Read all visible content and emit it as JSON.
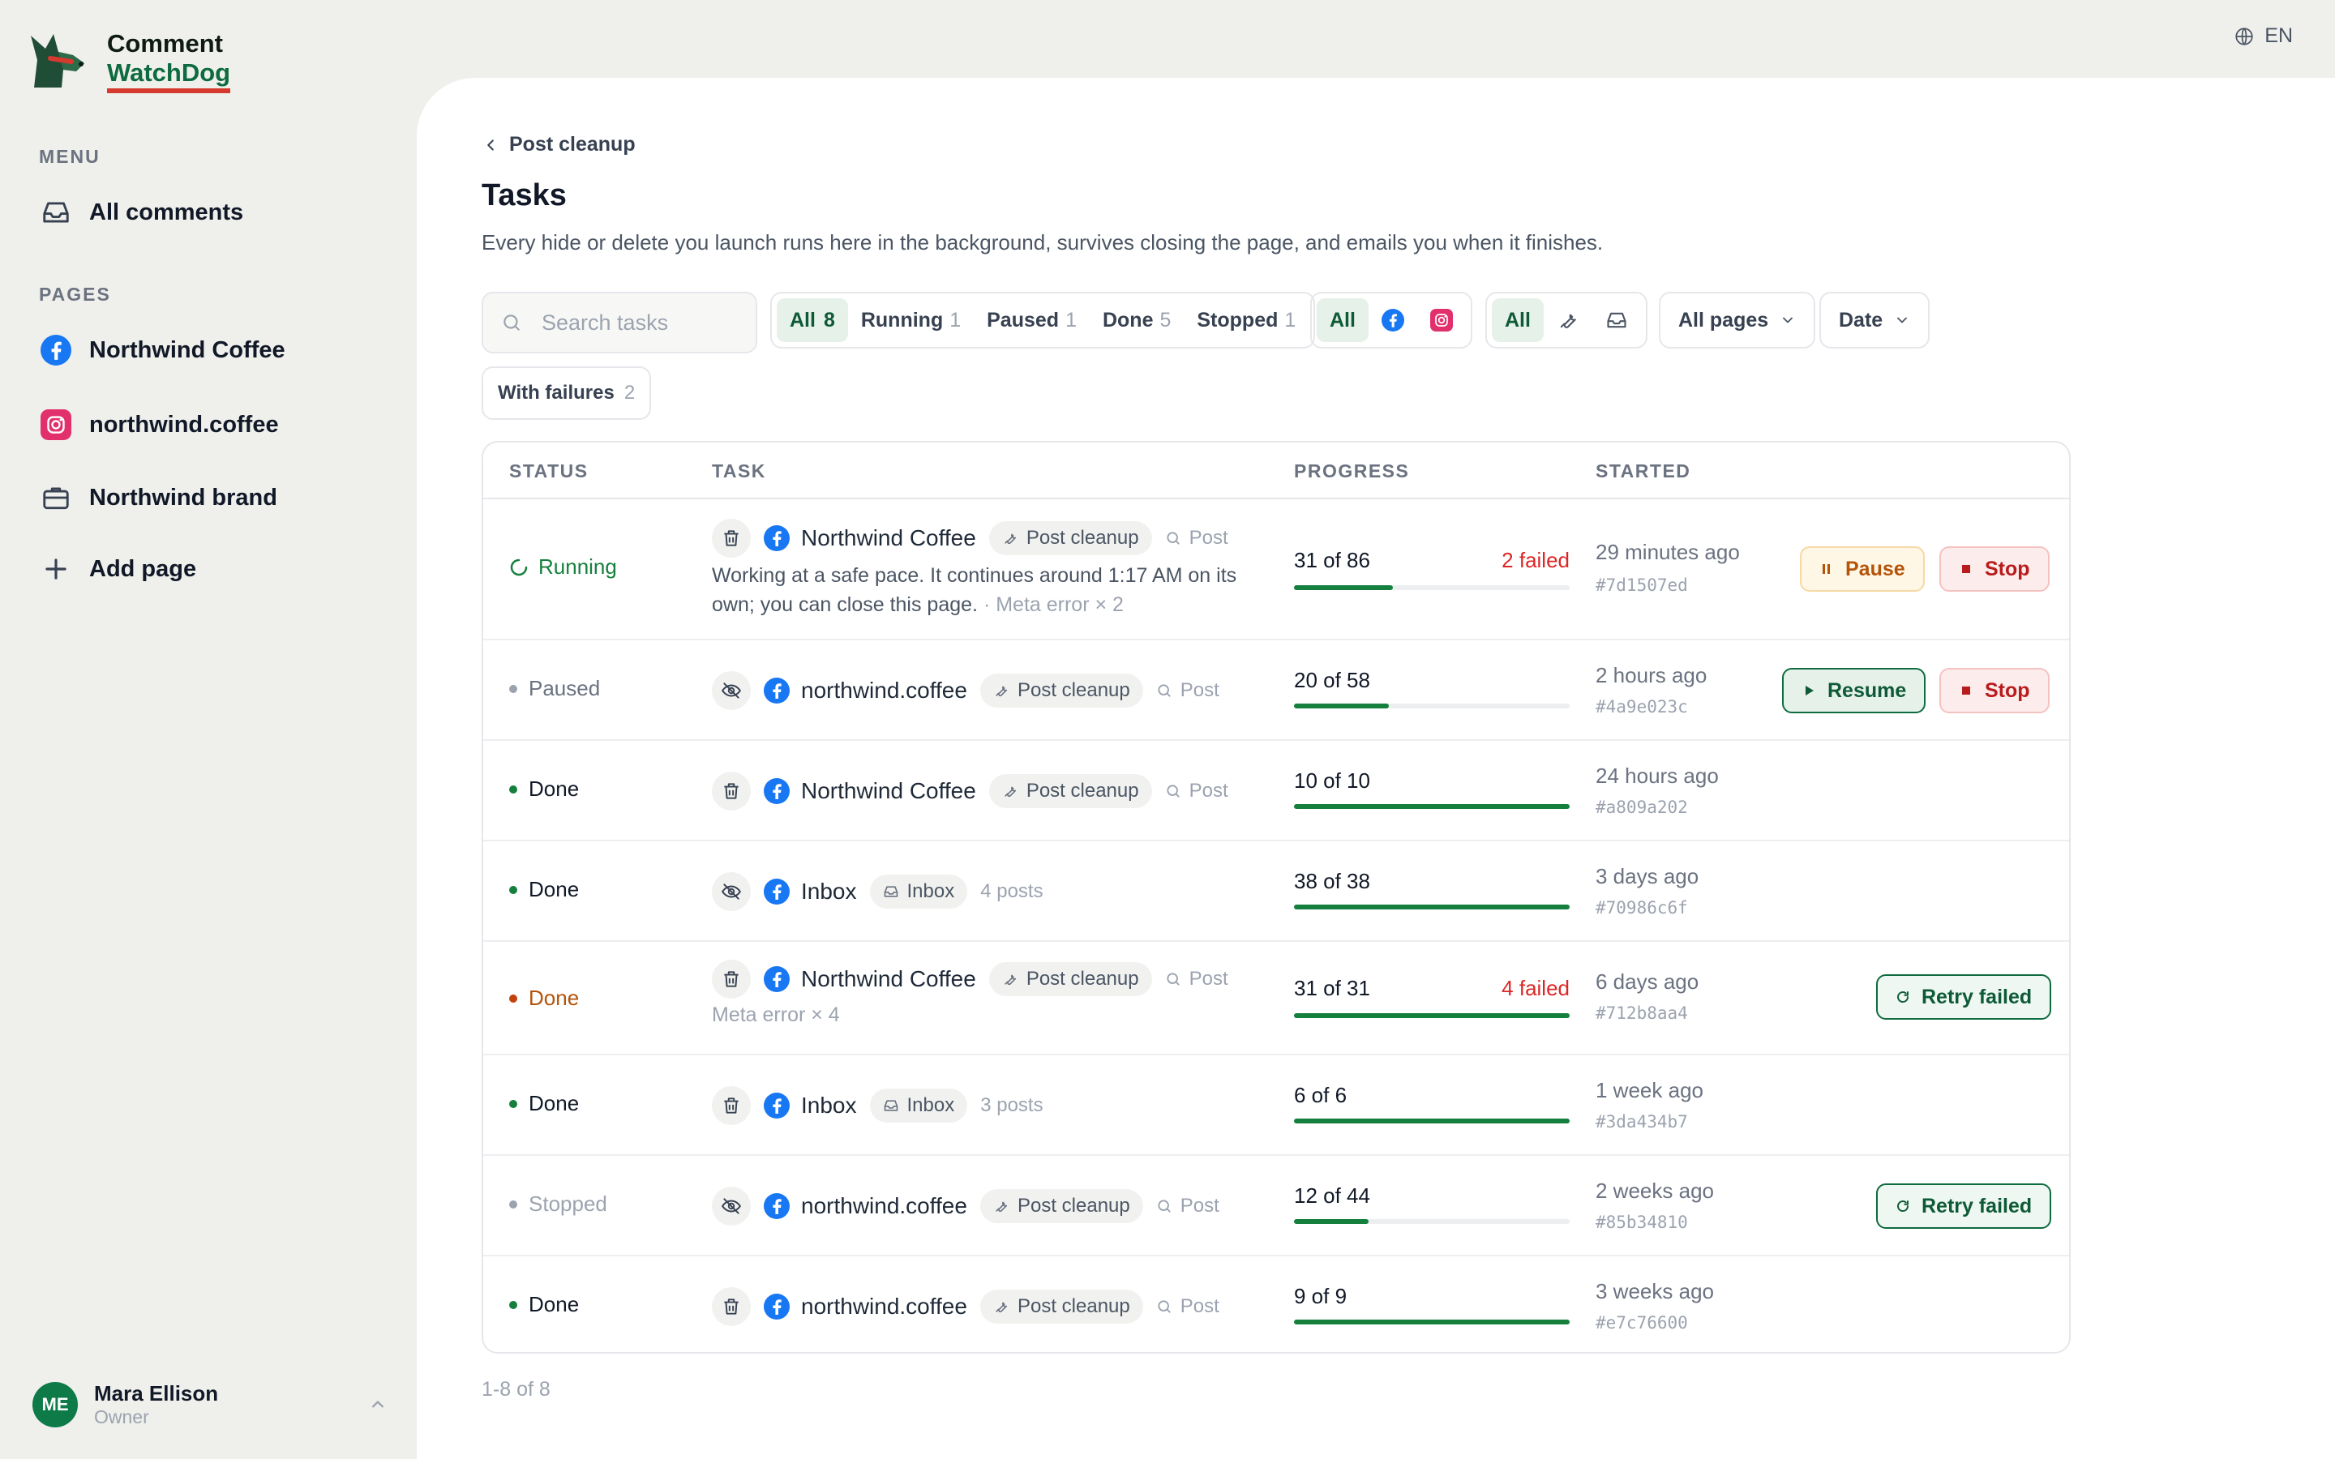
{
  "app": {
    "name_line1": "Comment",
    "name_line2": "WatchDog",
    "language": "EN"
  },
  "sidebar": {
    "menu_heading": "MENU",
    "menu_items": [
      {
        "label": "All comments",
        "icon": "inbox-icon"
      }
    ],
    "pages_heading": "PAGES",
    "pages": [
      {
        "label": "Northwind Coffee",
        "icon": "facebook-icon"
      },
      {
        "label": "northwind.coffee",
        "icon": "instagram-icon"
      },
      {
        "label": "Northwind brand",
        "icon": "briefcase-icon"
      }
    ],
    "add_page_label": "Add page",
    "user": {
      "initials": "ME",
      "name": "Mara Ellison",
      "role": "Owner"
    }
  },
  "header": {
    "breadcrumb": "Post cleanup",
    "title": "Tasks",
    "subtitle": "Every hide or delete you launch runs here in the background, survives closing the page, and emails you when it finishes."
  },
  "filters": {
    "search_placeholder": "Search tasks",
    "status_options": [
      {
        "label": "All",
        "count": "8",
        "active": true
      },
      {
        "label": "Running",
        "count": "1"
      },
      {
        "label": "Paused",
        "count": "1"
      },
      {
        "label": "Done",
        "count": "5"
      },
      {
        "label": "Stopped",
        "count": "1"
      }
    ],
    "platform_all": "All",
    "action_all": "All",
    "pages_dropdown": "All pages",
    "date_dropdown": "Date",
    "with_failures_label": "With failures",
    "with_failures_count": "2"
  },
  "table": {
    "headers": {
      "status": "STATUS",
      "task": "TASK",
      "progress": "PROGRESS",
      "started": "STARTED"
    },
    "rows": [
      {
        "status": "Running",
        "action_icon": "trash-icon",
        "page": "Northwind Coffee",
        "tag": "Post cleanup",
        "scope": "Post",
        "note": "Working at a safe pace. It continues around 1:17 AM on its own; you can close this page.",
        "note_extra": "· Meta error × 2",
        "progress": "31 of 86",
        "progress_fraction": 0.36,
        "failed": "2 failed",
        "started": "29 minutes ago",
        "hash": "#7d1507ed",
        "buttons": [
          "Pause",
          "Stop"
        ]
      },
      {
        "status": "Paused",
        "action_icon": "eye-off-icon",
        "page": "northwind.coffee",
        "tag": "Post cleanup",
        "scope": "Post",
        "progress": "20 of 58",
        "progress_fraction": 0.345,
        "started": "2 hours ago",
        "hash": "#4a9e023c",
        "buttons": [
          "Resume",
          "Stop"
        ]
      },
      {
        "status": "Done",
        "action_icon": "trash-icon",
        "page": "Northwind Coffee",
        "tag": "Post cleanup",
        "scope": "Post",
        "progress": "10 of 10",
        "progress_fraction": 1,
        "started": "24 hours ago",
        "hash": "#a809a202"
      },
      {
        "status": "Done",
        "action_icon": "eye-off-icon",
        "page": "Inbox",
        "tag": "Inbox",
        "scope": "4 posts",
        "progress": "38 of 38",
        "progress_fraction": 1,
        "started": "3 days ago",
        "hash": "#70986c6f"
      },
      {
        "status": "Done",
        "action_icon": "trash-icon",
        "page": "Northwind Coffee",
        "tag": "Post cleanup",
        "scope": "Post",
        "note_extra": "Meta error × 4",
        "progress": "31 of 31",
        "progress_fraction": 1,
        "failed": "4 failed",
        "started": "6 days ago",
        "hash": "#712b8aa4",
        "buttons": [
          "Retry failed"
        ]
      },
      {
        "status": "Done",
        "action_icon": "trash-icon",
        "page": "Inbox",
        "tag": "Inbox",
        "scope": "3 posts",
        "progress": "6 of 6",
        "progress_fraction": 1,
        "started": "1 week ago",
        "hash": "#3da434b7"
      },
      {
        "status": "Stopped",
        "action_icon": "eye-off-icon",
        "page": "northwind.coffee",
        "tag": "Post cleanup",
        "scope": "Post",
        "progress": "12 of 44",
        "progress_fraction": 0.27,
        "started": "2 weeks ago",
        "hash": "#85b34810",
        "buttons": [
          "Retry failed"
        ]
      },
      {
        "status": "Done",
        "action_icon": "trash-icon",
        "page": "northwind.coffee",
        "tag": "Post cleanup",
        "scope": "Post",
        "progress": "9 of 9",
        "progress_fraction": 1,
        "started": "3 weeks ago",
        "hash": "#e7c76600"
      }
    ]
  },
  "pagination": {
    "range": "1-8 of 8"
  },
  "colors": {
    "accent": "#0e6b3f",
    "danger": "#dc2626",
    "warning": "#b45309",
    "running": "#15803d"
  }
}
